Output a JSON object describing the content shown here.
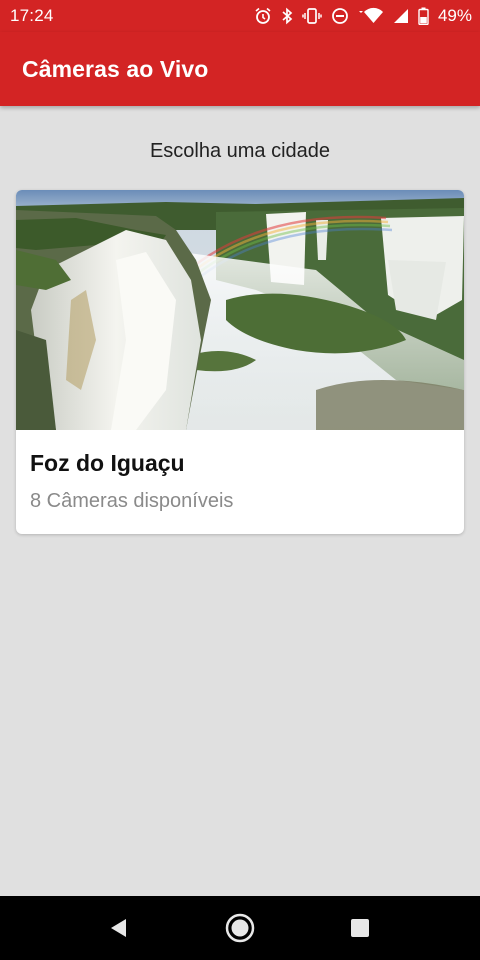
{
  "status_bar": {
    "time": "17:24",
    "battery": "49%",
    "icons": [
      "alarm-icon",
      "bluetooth-icon",
      "vibrate-icon",
      "do-not-disturb-icon",
      "wifi-icon",
      "signal-icon",
      "battery-icon"
    ]
  },
  "app_bar": {
    "title": "Câmeras ao Vivo"
  },
  "main": {
    "prompt": "Escolha uma cidade",
    "cities": [
      {
        "name": "Foz do Iguaçu",
        "subtitle": "8 Câmeras disponíveis",
        "image": "waterfall-photo"
      }
    ]
  },
  "nav_bar": {
    "icons": [
      "back-icon",
      "home-icon",
      "recents-icon"
    ]
  },
  "colors": {
    "primary": "#d32424",
    "background": "#e0e0e0",
    "card": "#ffffff"
  }
}
